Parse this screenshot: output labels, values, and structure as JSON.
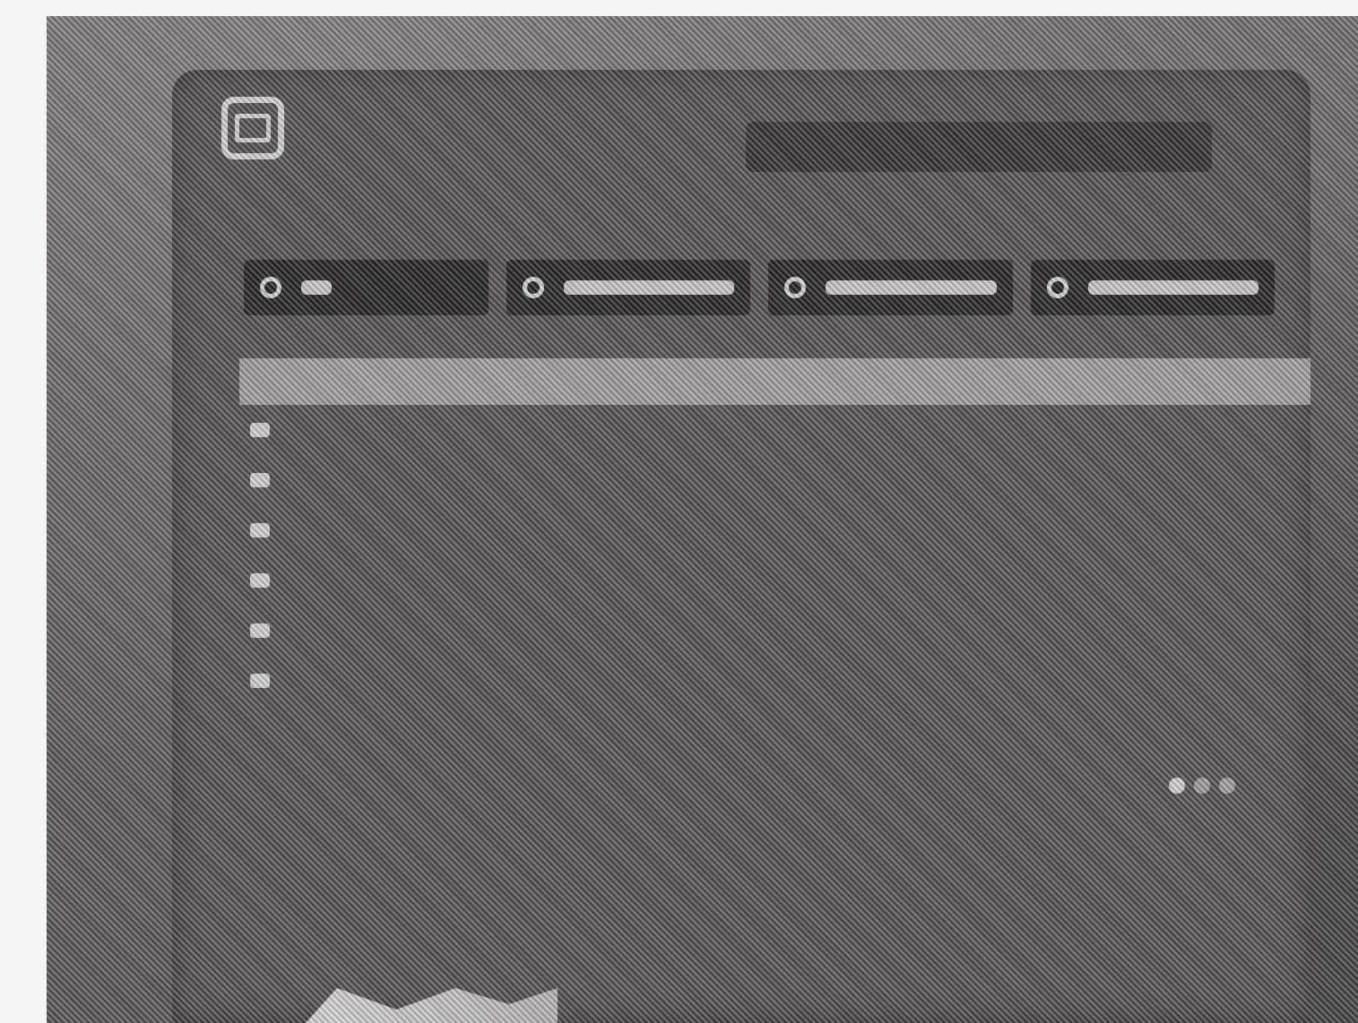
{
  "app": {
    "title": "",
    "icon": "tv-icon"
  },
  "tabs": [
    {
      "icon": "radio-dot-icon",
      "label": ""
    },
    {
      "icon": "radio-dot-icon",
      "label": ""
    },
    {
      "icon": "radio-dot-icon",
      "label": ""
    },
    {
      "icon": "radio-dot-icon",
      "label": ""
    }
  ],
  "list": {
    "header": "",
    "items": [
      {
        "label": ""
      },
      {
        "label": ""
      },
      {
        "label": ""
      },
      {
        "label": ""
      },
      {
        "label": ""
      },
      {
        "label": ""
      }
    ]
  },
  "pager": {
    "pages": 3,
    "current": 1
  },
  "colors": {
    "screen": "#5d575b",
    "tab_bg": "#2f2b2e",
    "list_header_bg": "#a8a3a6",
    "text": "#d7d4d6"
  }
}
